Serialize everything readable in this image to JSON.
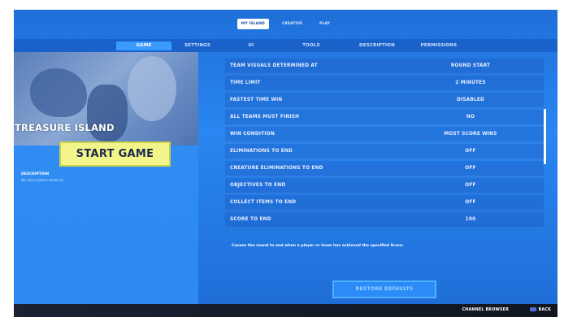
{
  "top_tabs": [
    "MY ISLAND",
    "CREATIVE",
    "PLAY"
  ],
  "sub_tabs": [
    "GAME",
    "SETTINGS",
    "UI",
    "TOOLS",
    "DESCRIPTION",
    "PERMISSIONS"
  ],
  "island": {
    "title": "TREASURE ISLAND",
    "start_label": "START GAME",
    "description_label": "DESCRIPTION",
    "description_text": "No description entered"
  },
  "settings": [
    {
      "label": "TEAM VISUALS DETERMINED AT",
      "value": "ROUND START"
    },
    {
      "label": "TIME LIMIT",
      "value": "2 MINUTES"
    },
    {
      "label": "FASTEST TIME WIN",
      "value": "DISABLED"
    },
    {
      "label": "ALL TEAMS MUST FINISH",
      "value": "NO"
    },
    {
      "label": "WIN CONDITION",
      "value": "MOST SCORE WINS"
    },
    {
      "label": "ELIMINATIONS TO END",
      "value": "OFF"
    },
    {
      "label": "CREATURE ELIMINATIONS TO END",
      "value": "OFF"
    },
    {
      "label": "OBJECTIVES TO END",
      "value": "OFF"
    },
    {
      "label": "COLLECT ITEMS TO END",
      "value": "OFF"
    },
    {
      "label": "SCORE TO END",
      "value": "100"
    }
  ],
  "hint": "Causes the round to end when a player or team has achieved the specified Score.",
  "restore_label": "RESTORE DEFAULTS",
  "bottom": {
    "channel_browser": "CHANNEL BROWSER",
    "back": "BACK"
  },
  "colors": {
    "accent": "#2b8cf7",
    "start_button": "#f1f58a"
  }
}
